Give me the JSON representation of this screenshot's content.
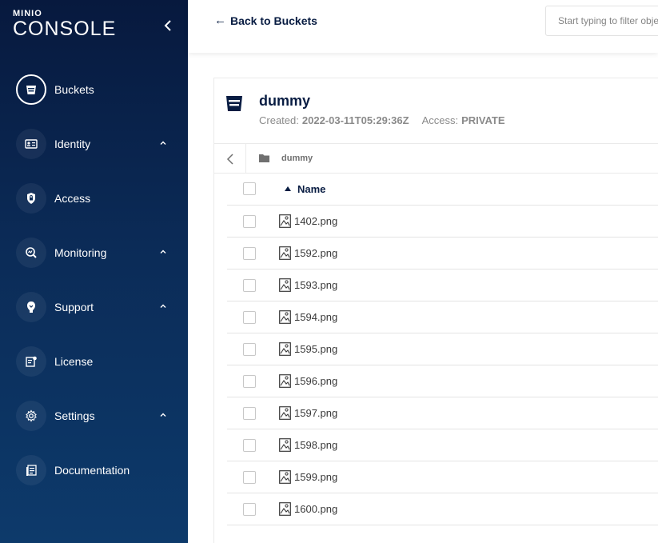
{
  "sidebar": {
    "logo_top": "MINIO",
    "logo_main": "CONSOLE",
    "items": [
      {
        "label": "Buckets",
        "icon": "bucket-icon",
        "active": true,
        "expandable": false
      },
      {
        "label": "Identity",
        "icon": "id-card-icon",
        "active": false,
        "expandable": true
      },
      {
        "label": "Access",
        "icon": "lock-icon",
        "active": false,
        "expandable": false
      },
      {
        "label": "Monitoring",
        "icon": "monitoring-icon",
        "active": false,
        "expandable": true
      },
      {
        "label": "Support",
        "icon": "support-icon",
        "active": false,
        "expandable": true
      },
      {
        "label": "License",
        "icon": "license-icon",
        "active": false,
        "expandable": false
      },
      {
        "label": "Settings",
        "icon": "gear-icon",
        "active": false,
        "expandable": true
      },
      {
        "label": "Documentation",
        "icon": "documentation-icon",
        "active": false,
        "expandable": false
      }
    ]
  },
  "header": {
    "back_label": "Back to Buckets",
    "filter_placeholder": "Start typing to filter objects"
  },
  "bucket": {
    "name": "dummy",
    "created_label": "Created:",
    "created_value": "2022-03-11T05:29:36Z",
    "access_label": "Access:",
    "access_value": "PRIVATE"
  },
  "breadcrumb": {
    "path": "dummy"
  },
  "table": {
    "column_name": "Name",
    "files": [
      "1402.png",
      "1592.png",
      "1593.png",
      "1594.png",
      "1595.png",
      "1596.png",
      "1597.png",
      "1598.png",
      "1599.png",
      "1600.png"
    ]
  },
  "colors": {
    "sidebar_top": "#07193e",
    "sidebar_bottom": "#0d3a6b",
    "text_dark": "#081c42"
  }
}
